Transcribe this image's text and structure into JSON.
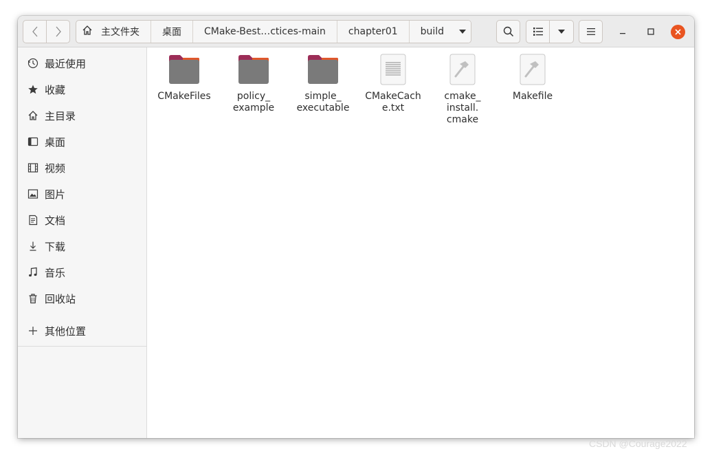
{
  "pathbar": {
    "home": "主文件夹",
    "crumbs": [
      "桌面",
      "CMake-Best…ctices-main",
      "chapter01",
      "build"
    ]
  },
  "sidebar": {
    "items": [
      {
        "label": "最近使用",
        "icon": "clock-icon"
      },
      {
        "label": "收藏",
        "icon": "star-icon"
      },
      {
        "label": "主目录",
        "icon": "home-icon"
      },
      {
        "label": "桌面",
        "icon": "desktop-icon"
      },
      {
        "label": "视频",
        "icon": "video-icon"
      },
      {
        "label": "图片",
        "icon": "picture-icon"
      },
      {
        "label": "文档",
        "icon": "document-icon"
      },
      {
        "label": "下载",
        "icon": "download-icon"
      },
      {
        "label": "音乐",
        "icon": "music-icon"
      },
      {
        "label": "回收站",
        "icon": "trash-icon"
      }
    ],
    "other": {
      "label": "其他位置",
      "icon": "plus-icon"
    }
  },
  "files": [
    {
      "lines": [
        "CMakeFiles"
      ],
      "type": "folder"
    },
    {
      "lines": [
        "policy_",
        "example"
      ],
      "type": "folder"
    },
    {
      "lines": [
        "simple_",
        "executable"
      ],
      "type": "folder"
    },
    {
      "lines": [
        "CMakeCach",
        "e.txt"
      ],
      "type": "text"
    },
    {
      "lines": [
        "cmake_",
        "install.",
        "cmake"
      ],
      "type": "script"
    },
    {
      "lines": [
        "Makefile"
      ],
      "type": "script"
    }
  ],
  "colors": {
    "close": "#e95420",
    "folder_tab": "#9c2d57",
    "folder_body": "#7a7a7a"
  },
  "watermark": "CSDN @Courage2022"
}
